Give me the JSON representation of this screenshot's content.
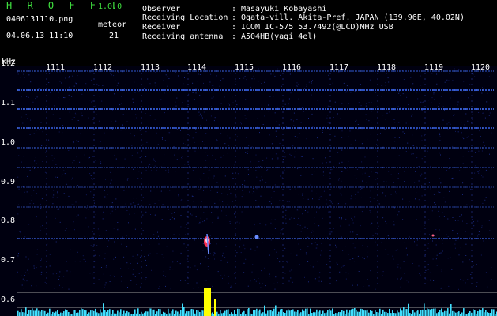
{
  "header": {
    "brand": "H R O F F T",
    "version": "1.0.0",
    "filename": "0406131110.png",
    "datetime": "04.06.13 11:10",
    "meteor_label": "meteor",
    "meteor_count": "21"
  },
  "info": [
    {
      "label": "Observer",
      "sep": ":",
      "value": "Masayuki Kobayashi"
    },
    {
      "label": "Receiving Location",
      "sep": ":",
      "value": "Ogata-vill. Akita-Pref. JAPAN (139.96E, 40.02N)"
    },
    {
      "label": "Receiver",
      "sep": ":",
      "value": "ICOM IC-575 53.7492(@LCD)MHz USB"
    },
    {
      "label": "Receiving antenna",
      "sep": ":",
      "value": "A504HB(yagi 4el)"
    }
  ],
  "axis": {
    "y_unit": "kHz",
    "y_ticks": [
      "1.2",
      "1.1",
      "1.0",
      "0.9",
      "0.8",
      "0.7",
      "0.6"
    ],
    "time_ticks": [
      "1111",
      "1112",
      "1113",
      "1114",
      "1115",
      "1116",
      "1117",
      "1118",
      "1119",
      "1120"
    ]
  },
  "colors": {
    "background": "#000000",
    "brand": "#3fe03f",
    "signal_lines": "#3c6cff",
    "meteor_echo": "#ff3050",
    "histogram": "#40e0ff",
    "histogram_peak": "#ffff00"
  }
}
